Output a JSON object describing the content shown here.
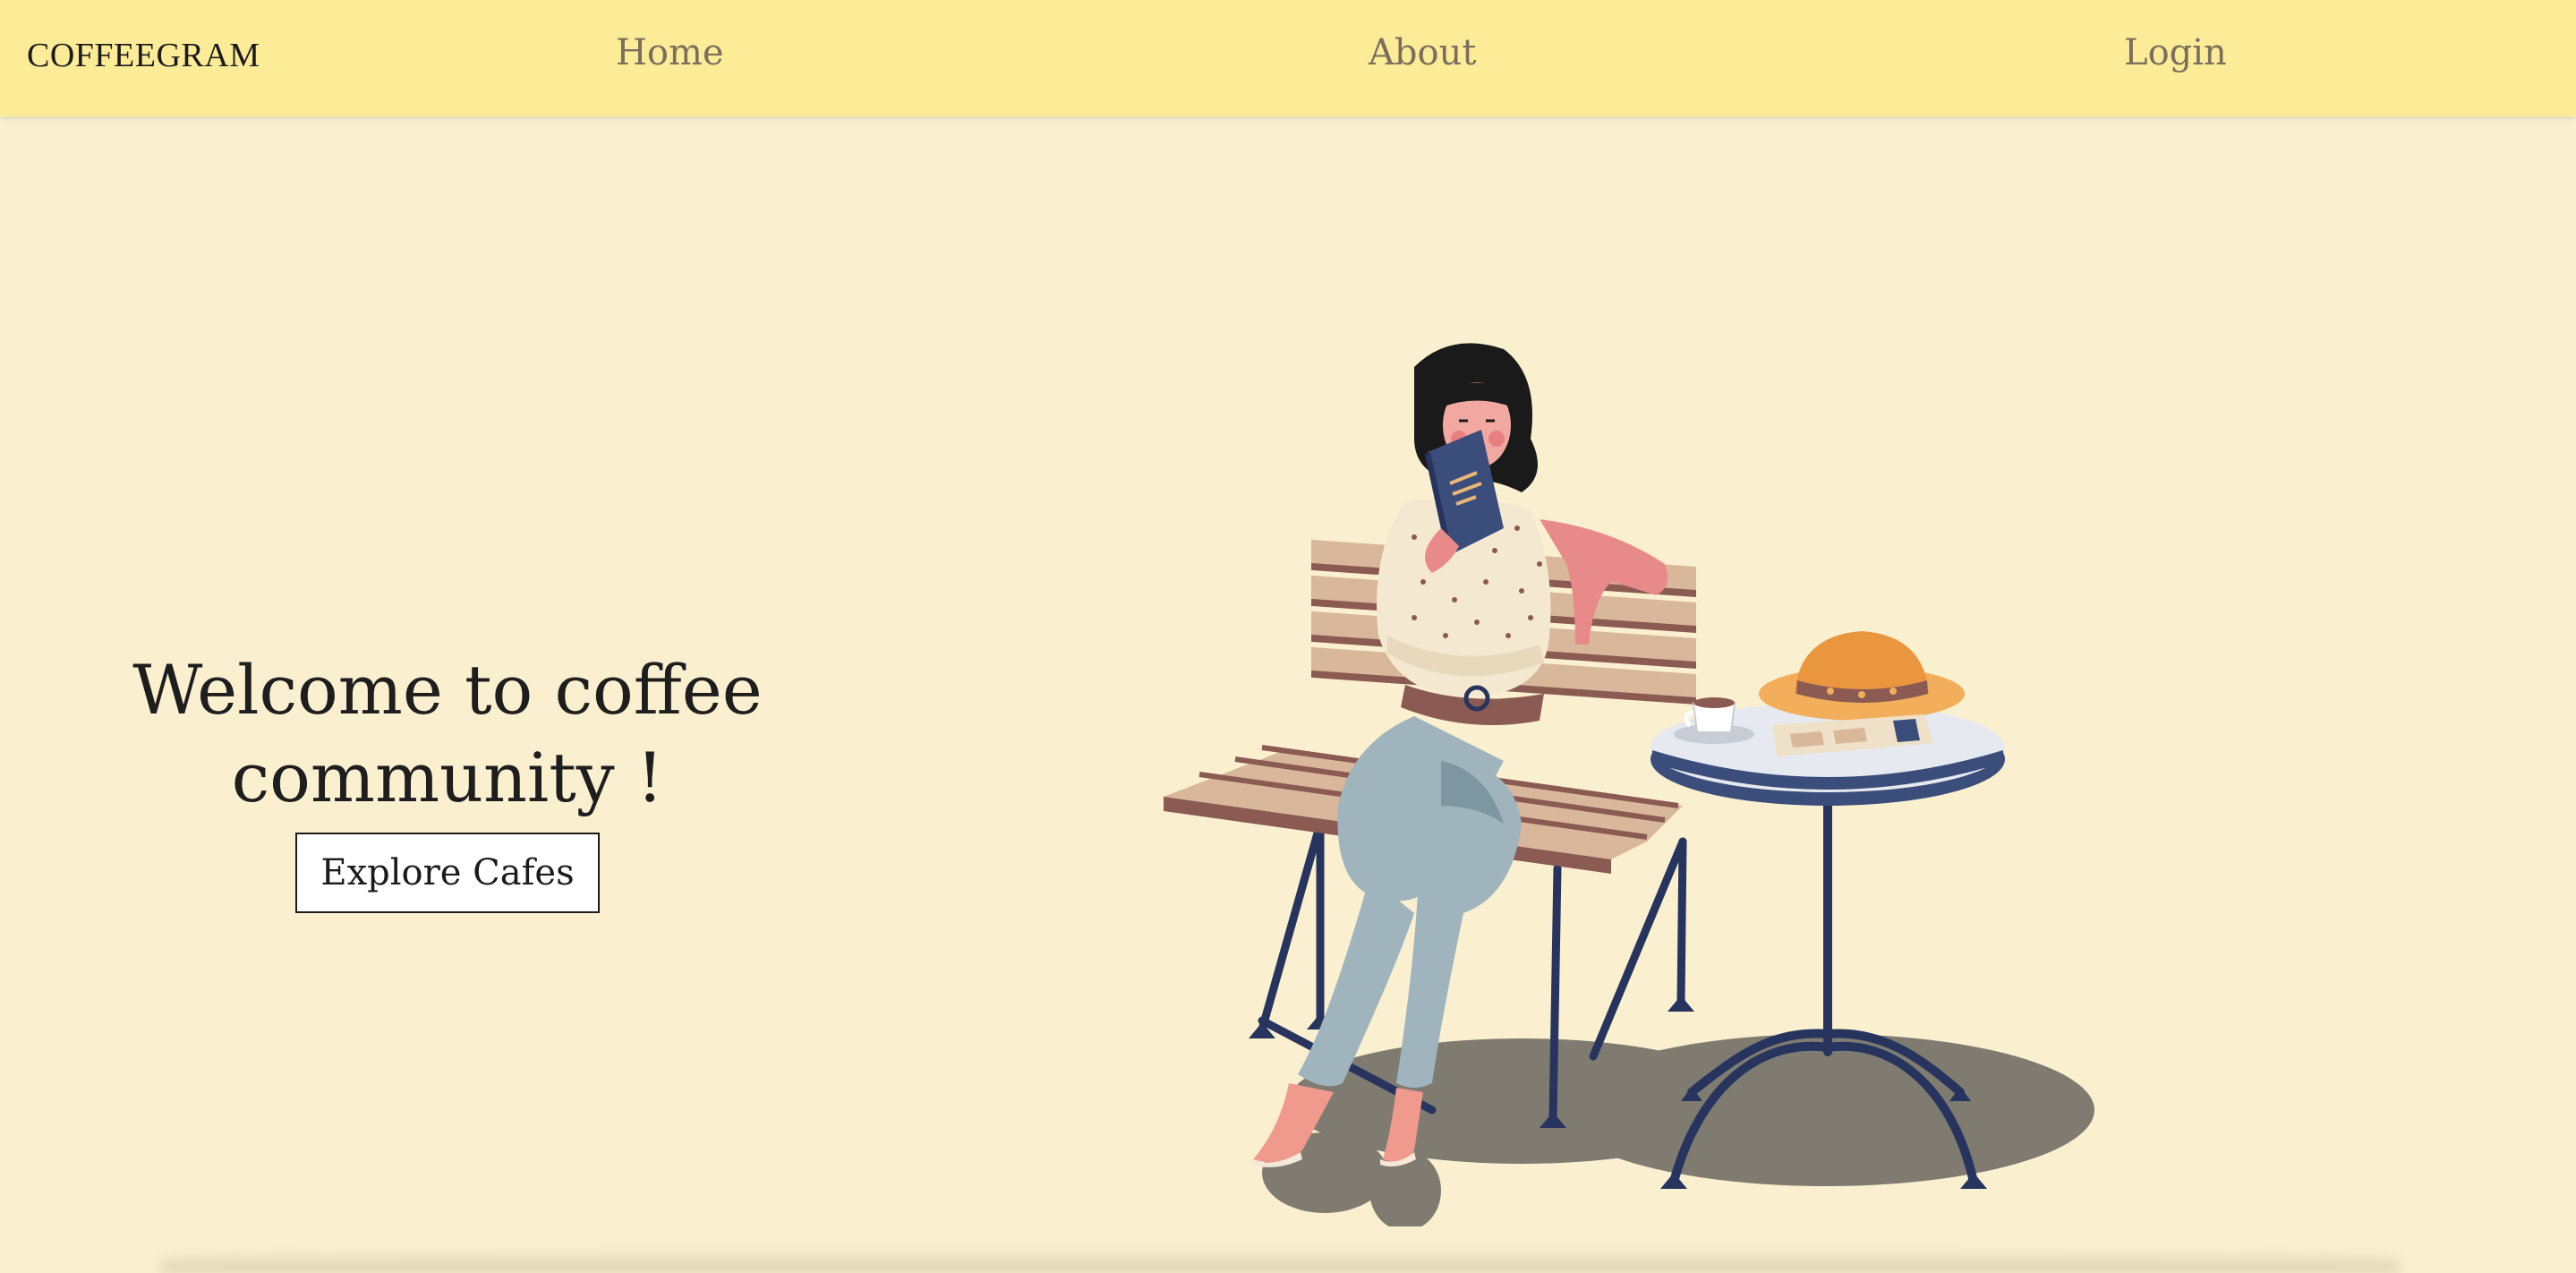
{
  "navbar": {
    "brand": "COFFEEGRAM",
    "links": [
      {
        "label": "Home"
      },
      {
        "label": "About"
      },
      {
        "label": "Login"
      }
    ]
  },
  "hero": {
    "title": "Welcome to coffee community !",
    "cta_label": "Explore Cafes"
  },
  "illustration": {
    "icon": "woman-reading-at-cafe-illustration"
  },
  "colors": {
    "navbar_bg": "#fcec98",
    "page_bg": "#faf0d0",
    "nav_text": "#7a6f5c",
    "book": "#3b4d7a",
    "jeans": "#9fb4bd",
    "bench_wood": "#d9b79a",
    "metal": "#27355e"
  }
}
